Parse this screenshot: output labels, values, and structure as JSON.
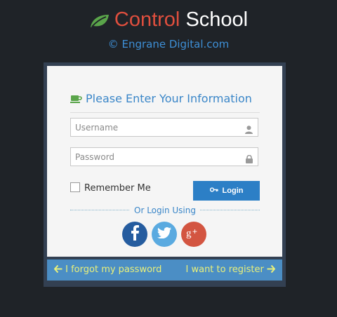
{
  "brand": {
    "word1": "Control",
    "word2": "School",
    "logo_icon": "leaf-icon",
    "colors": {
      "word1": "#e04f3e",
      "word2": "#ffffff",
      "leaf": "#5aa54a"
    }
  },
  "copyright": "© Engrane Digital.com",
  "form": {
    "title": "Please Enter Your Information",
    "title_icon": "cup-icon",
    "username_placeholder": "Username",
    "password_placeholder": "Password",
    "remember_label": "Remember Me",
    "login_label": "Login",
    "or_login_using": "Or Login Using",
    "social": [
      {
        "name": "facebook",
        "glyph": "f",
        "color": "#255c9f"
      },
      {
        "name": "twitter",
        "glyph": "twitter-bird",
        "color": "#5aaae0"
      },
      {
        "name": "google-plus",
        "glyph": "g+",
        "color": "#d35541"
      }
    ]
  },
  "footer": {
    "forgot": "I forgot my password",
    "register": "I want to register",
    "text_color": "#e9f07a",
    "background": "#4b8ec5"
  }
}
